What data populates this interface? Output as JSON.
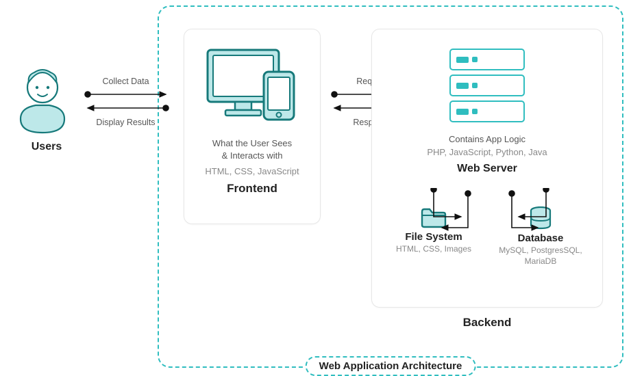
{
  "diagram_title": "Web Application Architecture",
  "users": {
    "label": "Users"
  },
  "arrows": {
    "collect": "Collect Data",
    "display": "Display Results",
    "request": "Request",
    "response": "Response"
  },
  "frontend": {
    "desc1": "What the User Sees",
    "desc2": "& Interacts with",
    "tech": "HTML, CSS, JavaScript",
    "title": "Frontend"
  },
  "backend": {
    "title": "Backend",
    "appserver": {
      "desc": "Contains App Logic",
      "tech": "PHP, JavaScript, Python, Java",
      "title": "Web Server"
    },
    "filesystem": {
      "title": "File System",
      "tech": "HTML, CSS, Images"
    },
    "database": {
      "title": "Database",
      "tech": "MySQL, PostgresSQL, MariaDB"
    }
  }
}
